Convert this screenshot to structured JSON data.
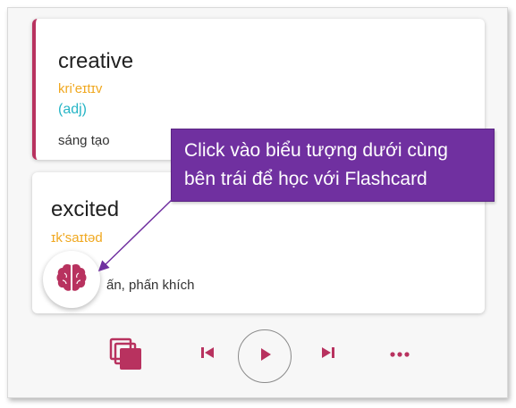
{
  "colors": {
    "accent": "#b8325f",
    "ipa": "#f0a820",
    "part_of_speech": "#26b5c6",
    "callout_bg": "#7030a0"
  },
  "cards": [
    {
      "word": "creative",
      "ipa": "kri'eɪtɪv",
      "pos": "(adj)",
      "meaning": "sáng tạo"
    },
    {
      "word": "excited",
      "ipa": "ɪk'saɪtəd",
      "meaning": "ấn, phấn khích"
    }
  ],
  "callout": {
    "line1": "Click vào biểu tượng dưới cùng",
    "line2": "bên trái để học với Flashcard"
  },
  "icons": {
    "brain": "brain-icon",
    "flashcards": "flashcards-stack-icon",
    "prev": "skip-previous-icon",
    "play": "play-icon",
    "next": "skip-next-icon",
    "more": "more-horizontal-icon"
  }
}
